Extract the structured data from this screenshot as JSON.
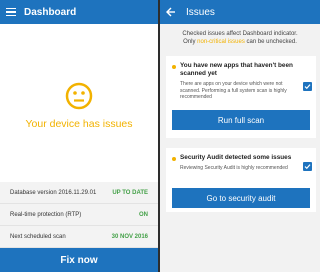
{
  "left": {
    "header": {
      "title": "Dashboard"
    },
    "status": {
      "text": "Your device has issues"
    },
    "info": [
      {
        "label": "Database version 2016.11.29.01",
        "value": "UP TO DATE"
      },
      {
        "label": "Real-time protection (RTP)",
        "value": "ON"
      },
      {
        "label": "Next scheduled scan",
        "value": "30 NOV 2016"
      }
    ],
    "fix_button": "Fix now"
  },
  "right": {
    "header": {
      "title": "Issues"
    },
    "note": {
      "line1": "Checked issues affect Dashboard indicator.",
      "line2_prefix": "Only ",
      "line2_highlight": "non-critical issues",
      "line2_suffix": " can be unchecked."
    },
    "issues": [
      {
        "title": "You have new apps that haven't been scanned yet",
        "description": "There are apps on your device which were not scanned. Performing a full system scan is highly recommended",
        "button": "Run full scan",
        "checked": true
      },
      {
        "title": "Security Audit detected some issues",
        "description": "Reviewing Security Audit is highly recommended",
        "button": "Go to security audit",
        "checked": true
      }
    ]
  },
  "colors": {
    "primary": "#1e73be",
    "warning": "#f2b200",
    "ok": "#43a047"
  }
}
